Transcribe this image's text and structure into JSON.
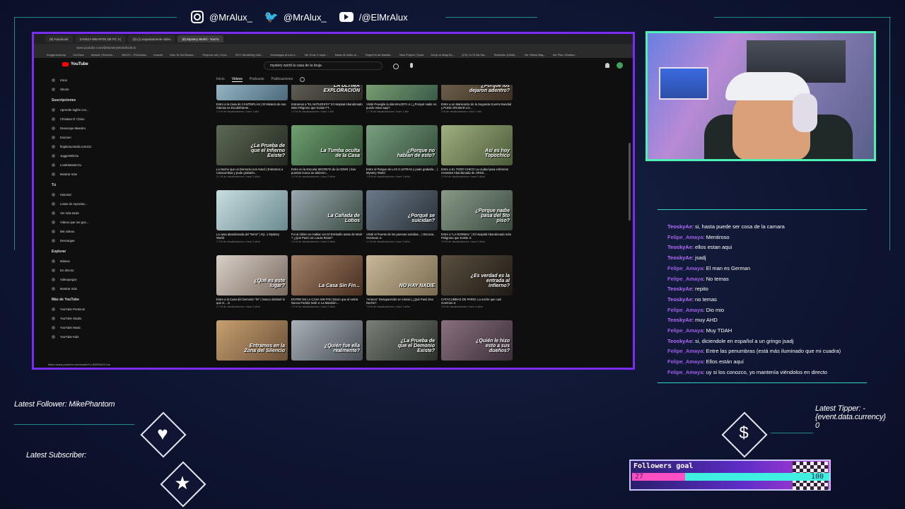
{
  "social": {
    "instagram": "@MrAlux_",
    "twitter": "@MrAlux_",
    "youtube": "/@ElMrAlux"
  },
  "browser": {
    "tabs": [
      "(9) Facebook",
      "3:NINJA WEAPON DE PC 3 |",
      "(3) (1) espantamente video",
      "(9) Mystery World - YouTu"
    ],
    "url": "www.youtube.com/@MysteryWorld/videos",
    "bookmarks": [
      "Keygeneraemp",
      "YouTube",
      "Abrinet | Servicio...",
      "INICIO – FixGames",
      "Imovini",
      "How To Get Banne...",
      "RepLink.me | Cont...",
      "RCC Modelring Voic...",
      "Descargas al root o...",
      "Ver Sora: Il nepe...",
      "Nana de estilo di...",
      "Regret is de Batalla...",
      "New Project | Sport",
      "Kenji no Magi Ep...",
      "(2/3) Yu Gi Ba Sta...",
      "Redictitor (GAM)...",
      "Ver Yellow Bag...",
      "Ver Piso: IDeditor..."
    ],
    "status_url": "https://www.youtube.com/watch?v=ID2RZkXC1vo"
  },
  "youtube": {
    "logo": "YouTube",
    "search_query": "mystery world la casa de la bruja",
    "chips": [
      "Inicio",
      "Videos",
      "Podcasts",
      "Publicaciones"
    ],
    "sidebar_top": [
      "Inicio",
      "Shorts"
    ],
    "subs_header": "Suscripciones",
    "subscriptions": [
      "Aprende Inglés con...",
      "Christian D' Clario",
      "Desecape Maestro",
      "Esomen",
      "fingfansomtobi.com101",
      "JuggerWitcho",
      "LostinMotaICCL",
      "Mostrar más"
    ],
    "you_header": "Tú",
    "you_items": [
      "Historial",
      "Listas de reproduc...",
      "Ver más tarde",
      "Videos que me gus...",
      "Mis videos",
      "Descargas"
    ],
    "explore_header": "Explorar",
    "explore_items": [
      "Música",
      "En directo",
      "Videojuegos",
      "Mostrar más"
    ],
    "more_header": "Más de YouTube",
    "more_items": [
      "YouTube Premium",
      "YouTube Studio",
      "YouTube Music",
      "YouTube Kids"
    ],
    "videos": [
      {
        "title": "Entro a la Casa de CANTINFLAS | El Misterio de sus Sitenas es EscalofrIante...",
        "meta": "1.2 M de visualizaciones • hace 1 año",
        "overlay": "",
        "c1": "#a8c8d8",
        "c2": "#4d6a7a"
      },
      {
        "title": "Entramos a \"EL NATURISTA\" El Hospital Abandonado Más Peligroso que Existe FT...",
        "meta": "1.9 M de visualizaciones • hace 1 año",
        "overlay": "LA ÚLTIMA EXPLORACIÓN",
        "c1": "#6d6a60",
        "c2": "#2b2a26"
      },
      {
        "title": "Visité Poveglia la isla MALDITA ⊘ | ¿Porqué nadie no puede estar aquí?",
        "meta": "1.7 M de visualizaciones • hace 1 año",
        "overlay": "",
        "c1": "#8ab07a",
        "c2": "#3a5a4a"
      },
      {
        "title": "Entre a un Manicomio de la Segunda Guerra Mundial y PUDE GRABAR LO...",
        "meta": "2 M de visualizaciones • hace 1 año",
        "overlay": "¿Porque los dejaron adentro?",
        "c1": "#7a6a55",
        "c2": "#3a2f22"
      },
      {
        "title": "La Noche que un Demonio nos Atacó | Entramos a Catacumbas y pude grabarlo...",
        "meta": "2.1 M de visualizaciones • hace 2 años",
        "overlay": "¿La Prueba de que el Infierno Existe?",
        "c1": "#5d6a55",
        "c2": "#232820"
      },
      {
        "title": "Entro en la Escuela SECRETA de la CDMX | Sus puertas nunca se abrieron...",
        "meta": "1.9 M de visualizaciones • hace 2 años",
        "overlay": "La Tumba oculta de la Casa",
        "c1": "#6fa070",
        "c2": "#2e4a30"
      },
      {
        "title": "Entre al Parque de LAS 3 LETRAS y pude grabarlo... | Mystery World",
        "meta": "1.9 M de visualizaciones • hace 2 años",
        "overlay": "¿Porque no hablan de esto?",
        "c1": "#7aa080",
        "c2": "#2f4a38"
      },
      {
        "title": "Entre a EL TODO CHICO La ciudad para enfermos mentales Abandonada de URSS...",
        "meta": "1.9 M de visualizaciones • hace 2 años",
        "overlay": "Así es hoy Topochico",
        "c1": "#9fb080",
        "c2": "#4a5a38"
      },
      {
        "title": "La casa abandonada del \"terror\" | Ep. 1 Mystery World",
        "meta": "1.3 M de visualizaciones • hace 2 años",
        "overlay": "",
        "c1": "#c8dde0",
        "c2": "#6a8a90"
      },
      {
        "title": "Fui al último en Hablar con El Ermitaño antes de Morir ? ¿Qué Pasó con Laura Rivas?",
        "meta": "1.9 M de visualizaciones • hace 2 años",
        "overlay": "La Cañada de Lobos",
        "c1": "#9aa8b0",
        "c2": "#3a4a40"
      },
      {
        "title": "Visité el Puente de los poemas suicidas... | Escocia , Overtoun ⊘",
        "meta": "1.2 M de visualizaciones • hace 2 años",
        "overlay": "¿Porqué se suicidan?",
        "c1": "#6a7a8a",
        "c2": "#2a2f35"
      },
      {
        "title": "Entre a \"LA NORMAL\" | El Hospital Abandonado más Peligroso que Existe ⊘",
        "meta": "1.9 M de visualizaciones • hace 2 años",
        "overlay": "¿Porque nadie pasa del 5to piso?",
        "c1": "#8a9a88",
        "c2": "#3a4a40"
      },
      {
        "title": "Entre a la Casa del Demonio \"M\" | Nunca olvidaré lo que vi... ⊘",
        "meta": "2.7 M de visualizaciones • hace 2 años",
        "overlay": "¿Qué es este lugar?",
        "c1": "#d8d0c8",
        "c2": "#7a6a60"
      },
      {
        "title": "ENTRE EN LA CASA SIN FIN | Dicen que al entrar Nunca Podrás Salir ⊘ La Mansión...",
        "meta": "1.9 M de visualizaciones • hace 2 años",
        "overlay": "La Casa Sin Fin...",
        "c1": "#a08068",
        "c2": "#4a2f20"
      },
      {
        "title": "\"Armero\" Desaparecido en Horas | ¿Qué Pasó Esa Noche?",
        "meta": "1.9 M de visualizaciones • hace 2 años",
        "overlay": "NO HAY NADIE",
        "c1": "#c8b898",
        "c2": "#7a6a50"
      },
      {
        "title": "CATACUMBAS DE PARIS: La noche que casi morimos ⊘",
        "meta": "4 M de visualizaciones • hace 4 años",
        "overlay": "¿Es verdad es la entrada al infierno?",
        "c1": "#5a5040",
        "c2": "#1f1a15"
      },
      {
        "title": "",
        "meta": "",
        "overlay": "Entramos en la Zona del Silencio",
        "c1": "#c8a070",
        "c2": "#6a5038"
      },
      {
        "title": "",
        "meta": "",
        "overlay": "¿Quién fue ella realmente?",
        "c1": "#a8b0b8",
        "c2": "#4a4f55"
      },
      {
        "title": "",
        "meta": "",
        "overlay": "¿La Prueba de que el Demonio Existe?",
        "c1": "#7a8078",
        "c2": "#2a2f2a"
      },
      {
        "title": "",
        "meta": "",
        "overlay": "¿Quién le hizo esto a sus dueños?",
        "c1": "#8a7080",
        "c2": "#3a2f38"
      }
    ]
  },
  "chat": {
    "messages": [
      {
        "user": "TeoskyAe",
        "text": ": si, hasta puede ser cosa de la camara",
        "color": "#b56cff"
      },
      {
        "user": "Felipe_Amaya",
        "text": ": Mentiroso",
        "color": "#a05ee8"
      },
      {
        "user": "TeoskyAe",
        "text": ": ellos estan aqui",
        "color": "#b56cff"
      },
      {
        "user": "TeoskyAe",
        "text": ": jsadj",
        "color": "#b56cff"
      },
      {
        "user": "Felipe_Amaya",
        "text": ": El man es German",
        "color": "#a05ee8"
      },
      {
        "user": "Felipe_Amaya",
        "text": ": No temas",
        "color": "#a05ee8"
      },
      {
        "user": "TeoskyAe",
        "text": ": repito",
        "color": "#b56cff"
      },
      {
        "user": "TeoskyAe",
        "text": ": no temas",
        "color": "#b56cff"
      },
      {
        "user": "Felipe_Amaya",
        "text": ": Dio mio",
        "color": "#a05ee8"
      },
      {
        "user": "TeoskyAe",
        "text": ": muy AHD",
        "color": "#b56cff"
      },
      {
        "user": "Felipe_Amaya",
        "text": ": Muy TDAH",
        "color": "#a05ee8"
      },
      {
        "user": "TeoskyAe",
        "text": ": si, diciendole en español a un gringo jsadj",
        "color": "#b56cff"
      },
      {
        "user": "Felipe_Amaya",
        "text": ": Entre las penumbras (está más iluminado que mi cuadra)",
        "color": "#a05ee8"
      },
      {
        "user": "Felipe_Amaya",
        "text": ": Ellos están aquí",
        "color": "#a05ee8"
      },
      {
        "user": "Felipe_Amaya",
        "text": ": uy si los conozco, yo mantenía viéndolos en directo",
        "color": "#a05ee8"
      }
    ]
  },
  "overlay": {
    "latest_follower": "Latest Follower: MikePhantom",
    "latest_subscriber": "Latest Subscriber:",
    "latest_tipper_1": "Latest Tipper: -",
    "latest_tipper_2": "{event.data.currency}",
    "latest_tipper_3": "0",
    "heart_icon": "heart-icon",
    "star_icon": "star-icon",
    "dollar_icon": "dollar-icon",
    "goal_label": "Followers goal",
    "goal_current": "27",
    "goal_target": "100",
    "goal_progress": 0.27
  }
}
